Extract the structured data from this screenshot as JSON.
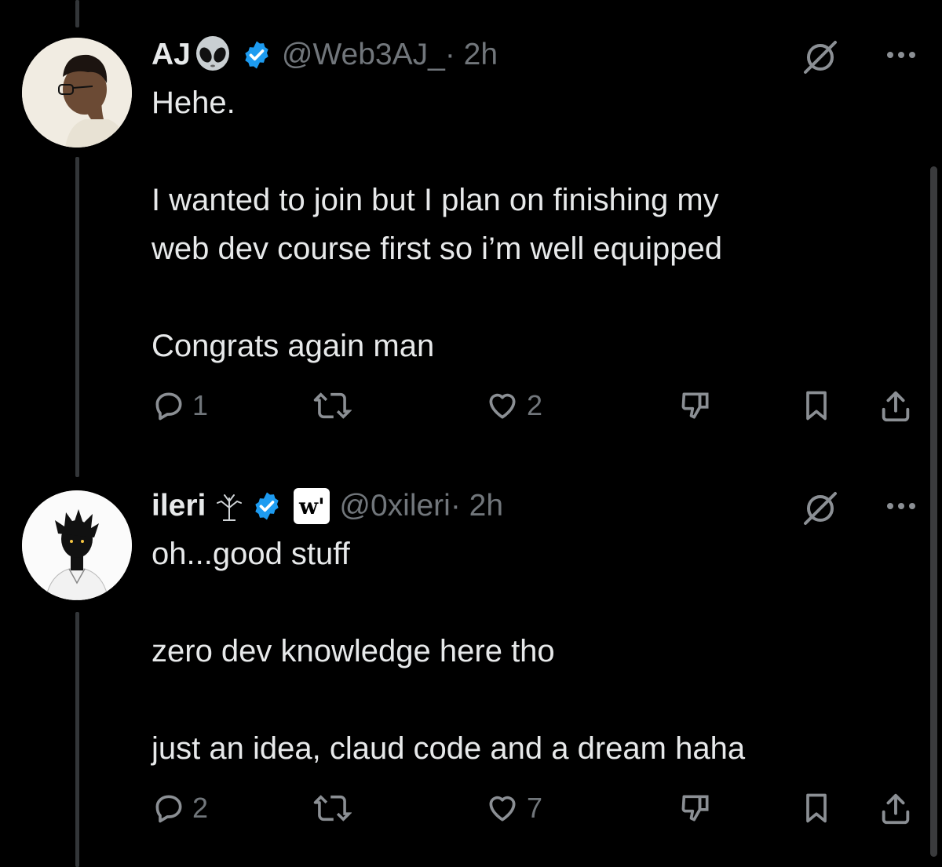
{
  "colors": {
    "background": "#000000",
    "text": "#e7e9ea",
    "muted": "#71767b",
    "verified": "#1d9bf0",
    "thread_line": "#333639"
  },
  "tweets": [
    {
      "name": "AJ",
      "name_emoji": "alien-emoji",
      "verified": true,
      "handle": "@Web3AJ_",
      "time": "· 2h",
      "body": "Hehe.\n\nI wanted to join but I plan on finishing my\nweb dev course first so i’m well equipped\n\nCongrats again man",
      "replies": "1",
      "reposts": "",
      "likes": "2",
      "icons": [
        "grok-icon",
        "more-icon",
        "reply-icon",
        "repost-icon",
        "like-icon",
        "downvote-icon",
        "bookmark-icon",
        "share-icon"
      ]
    },
    {
      "name": "ileri",
      "name_emoji": "seedling-glyph",
      "verified": true,
      "affiliate_badge": "w'",
      "handle": "@0xileri",
      "time": "· 2h",
      "body": "oh...good stuff\n\nzero dev knowledge here tho\n\njust an idea, claud code and a dream haha",
      "replies": "2",
      "reposts": "",
      "likes": "7",
      "icons": [
        "grok-icon",
        "more-icon",
        "reply-icon",
        "repost-icon",
        "like-icon",
        "downvote-icon",
        "bookmark-icon",
        "share-icon"
      ]
    }
  ]
}
